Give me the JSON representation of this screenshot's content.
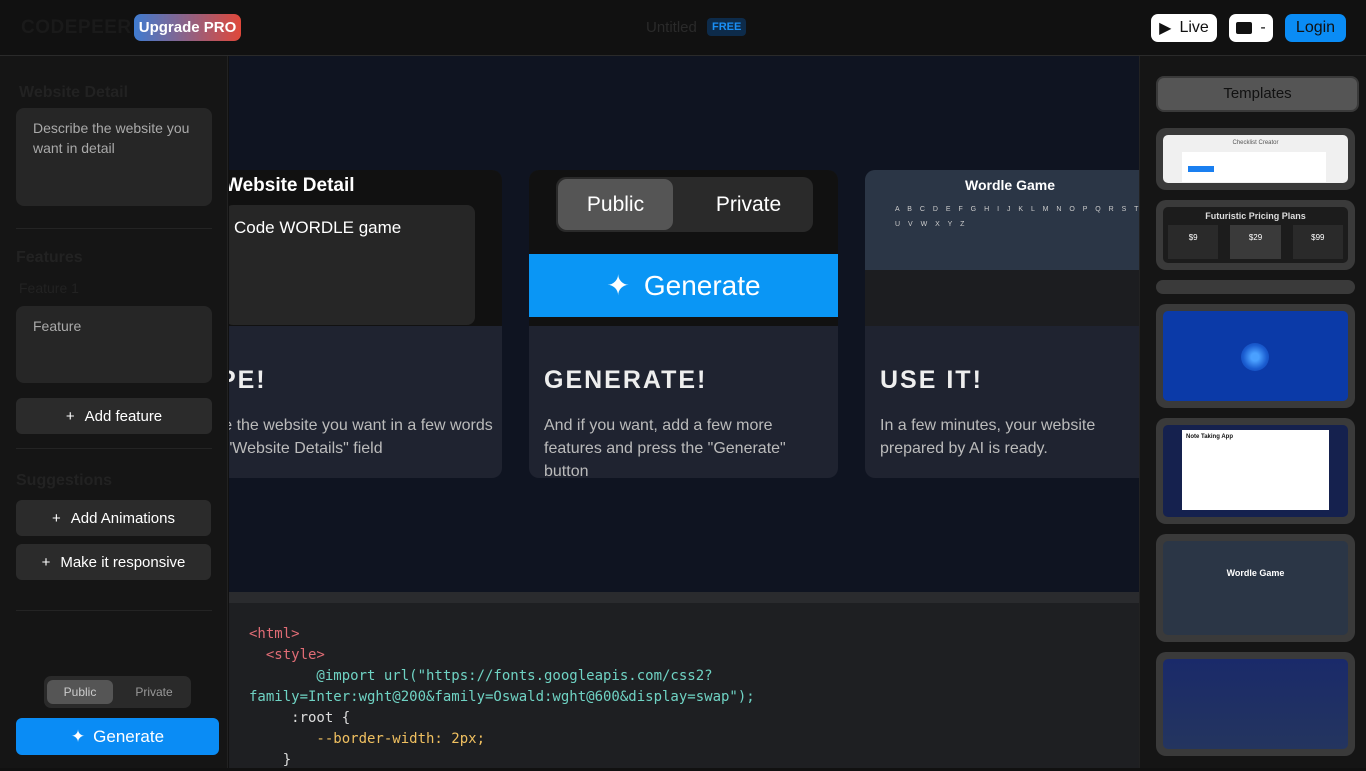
{
  "header": {
    "logo": "CODEPEER",
    "upgrade": "Upgrade PRO",
    "title": "Untitled",
    "plan_badge": "FREE",
    "live": "Live",
    "ticket_count": "-",
    "login": "Login"
  },
  "sidebar": {
    "website_detail_label": "Website Detail",
    "website_detail_placeholder": "Describe the website you want in detail",
    "features_label": "Features",
    "feature1_label": "Feature 1",
    "feature_placeholder": "Feature",
    "add_feature": "Add feature",
    "suggestions_label": "Suggestions",
    "suggestions": [
      "Add Animations",
      "Make it responsive"
    ],
    "visibility": {
      "options": [
        "Public",
        "Private"
      ],
      "selected": "Public"
    },
    "generate": "Generate"
  },
  "cards": [
    {
      "preview_title": "Website Detail",
      "preview_input": "Code WORDLE game",
      "title": "TYPE!",
      "text": "Describe the website you want in a few words in the \"Website Details\" field"
    },
    {
      "preview_options": [
        "Public",
        "Private"
      ],
      "preview_button": "Generate",
      "title": "GENERATE!",
      "text": "And if you want, add a few more features and press the \"Generate\" button"
    },
    {
      "preview_title": "Wordle Game",
      "preview_letters": "A B C D E F G H I J K L M N O P Q R S T U V W X Y Z",
      "title": "USE IT!",
      "text": "In a few minutes, your website prepared by AI is ready."
    }
  ],
  "code": {
    "lines": [
      "<html>",
      "  <style>",
      "        @import url(\"https://fonts.googleapis.com/css2?",
      "family=Inter:wght@200&family=Oswald:wght@600&display=swap\");",
      "     :root {",
      "        --border-width: 2px;",
      "    }"
    ]
  },
  "templates": {
    "button": "Templates",
    "items": [
      {
        "title": "Checklist Creator"
      },
      {
        "title": "Futuristic Pricing Plans",
        "plans": [
          "$9",
          "$29",
          "$99"
        ]
      },
      {
        "title": ""
      },
      {
        "title": ""
      },
      {
        "title": "Note Taking App"
      },
      {
        "title": "Wordle Game"
      },
      {
        "title": ""
      }
    ]
  }
}
